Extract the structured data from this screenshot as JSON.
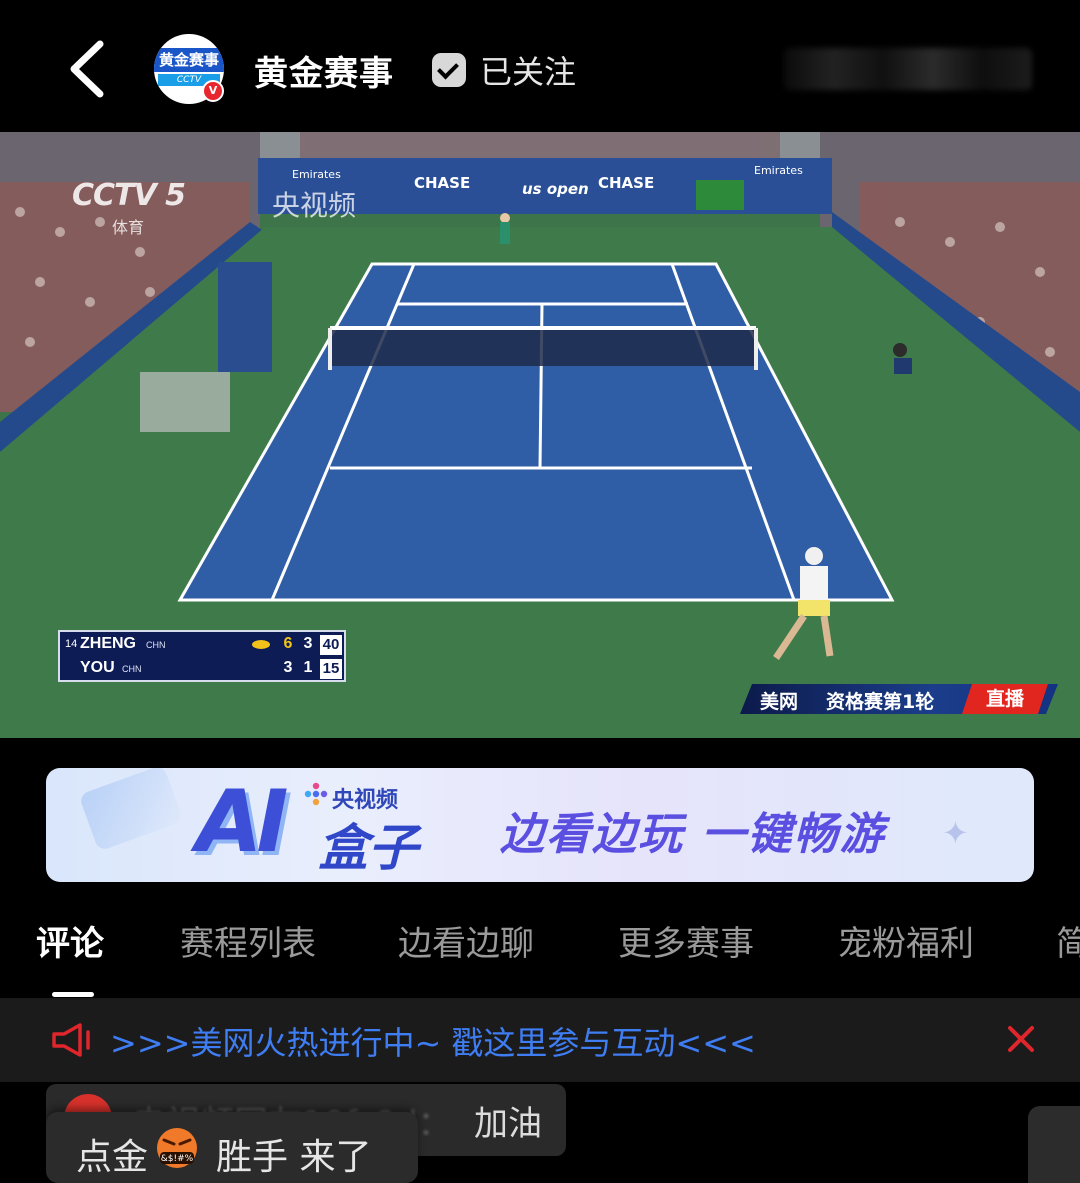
{
  "header": {
    "channel_name": "黄金赛事",
    "avatar_text_top": "黄金赛事",
    "avatar_text_bottom": "CCTV SPORTS",
    "avatar_badge": "V",
    "follow_label": "已关注"
  },
  "video": {
    "watermark_cctv": "CCTV 5",
    "watermark_cctv_sub": "体育",
    "watermark_app": "央视频",
    "boards": [
      "Emirates",
      "CHASE",
      "us open",
      "CHASE",
      "Emirates"
    ],
    "scoreboard": {
      "players": [
        {
          "seed": "14",
          "name": "ZHENG",
          "country": "CHN",
          "serving": true,
          "set1": "6",
          "set2": "3",
          "points": "40"
        },
        {
          "seed": "",
          "name": "YOU",
          "country": "CHN",
          "serving": false,
          "set1": "3",
          "set2": "1",
          "points": "15"
        }
      ]
    },
    "banner": {
      "event": "美网",
      "round": "资格赛第1轮",
      "live": "直播"
    }
  },
  "ad": {
    "ai": "AI",
    "brand": "央视频",
    "product": "盒子",
    "slogan": "边看边玩 一键畅游"
  },
  "tabs": [
    {
      "label": "评论",
      "active": true
    },
    {
      "label": "赛程列表",
      "active": false
    },
    {
      "label": "边看边聊",
      "active": false
    },
    {
      "label": "更多赛事",
      "active": false
    },
    {
      "label": "宠粉福利",
      "active": false
    },
    {
      "label": "简",
      "active": false
    }
  ],
  "notice": {
    "text": ">>>美网火热进行中~ 戳这里参与互动<<<"
  },
  "comments": [
    {
      "user": "央视频网友10f_0d：",
      "text": "加油"
    },
    {
      "text_before": "点金",
      "emoji_text": "&$!#%",
      "text_after": "胜手 来了"
    }
  ],
  "colors": {
    "accent_blue": "#3f7df3",
    "live_red": "#e0261f",
    "court_blue": "#2f5da6",
    "court_green": "#3f7a4a"
  }
}
